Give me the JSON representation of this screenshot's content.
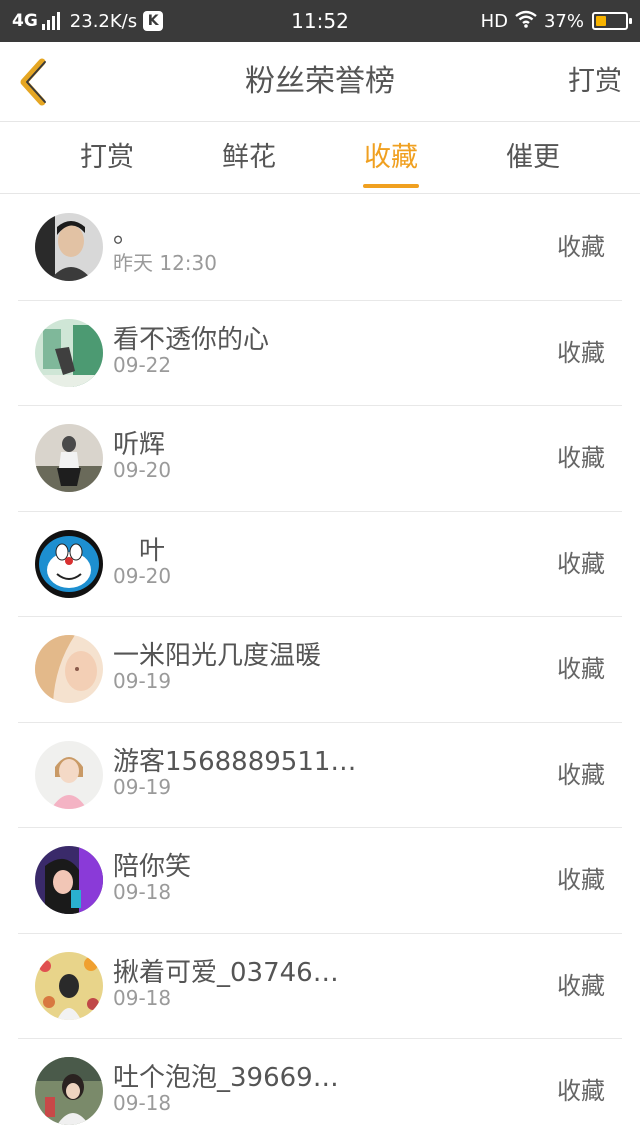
{
  "status_bar": {
    "network": "4G",
    "speed": "23.2K/s",
    "app_badge": "K",
    "time": "11:52",
    "hd": "HD",
    "battery": "37%",
    "battery_level": 0.37,
    "battery_color": "#f7b300"
  },
  "header": {
    "title": "粉丝荣誉榜",
    "action": "打赏",
    "back_icon": "chevron-left-icon"
  },
  "tabs": [
    {
      "label": "打赏",
      "active": false
    },
    {
      "label": "鲜花",
      "active": false
    },
    {
      "label": "收藏",
      "active": true
    },
    {
      "label": "催更",
      "active": false
    }
  ],
  "accent_color": "#f0a020",
  "fans": [
    {
      "name": "。",
      "date": "昨天 12:30",
      "action": "收藏",
      "avatar": "avatar-man"
    },
    {
      "name": "看不透你的心",
      "date": "09-22",
      "action": "收藏",
      "avatar": "avatar-green"
    },
    {
      "name": "听辉",
      "date": "09-20",
      "action": "收藏",
      "avatar": "avatar-girl-grey"
    },
    {
      "name": "　叶",
      "date": "09-20",
      "action": "收藏",
      "avatar": "avatar-doraemon"
    },
    {
      "name": "一米阳光几度温暖",
      "date": "09-19",
      "action": "收藏",
      "avatar": "avatar-blonde"
    },
    {
      "name": "游客1568889511…",
      "date": "09-19",
      "action": "收藏",
      "avatar": "avatar-girl-pink"
    },
    {
      "name": "陪你笑",
      "date": "09-18",
      "action": "收藏",
      "avatar": "avatar-purple"
    },
    {
      "name": "揪着可爱_03746…",
      "date": "09-18",
      "action": "收藏",
      "avatar": "avatar-flowers"
    },
    {
      "name": "吐个泡泡_39669…",
      "date": "09-18",
      "action": "收藏",
      "avatar": "avatar-street"
    }
  ]
}
